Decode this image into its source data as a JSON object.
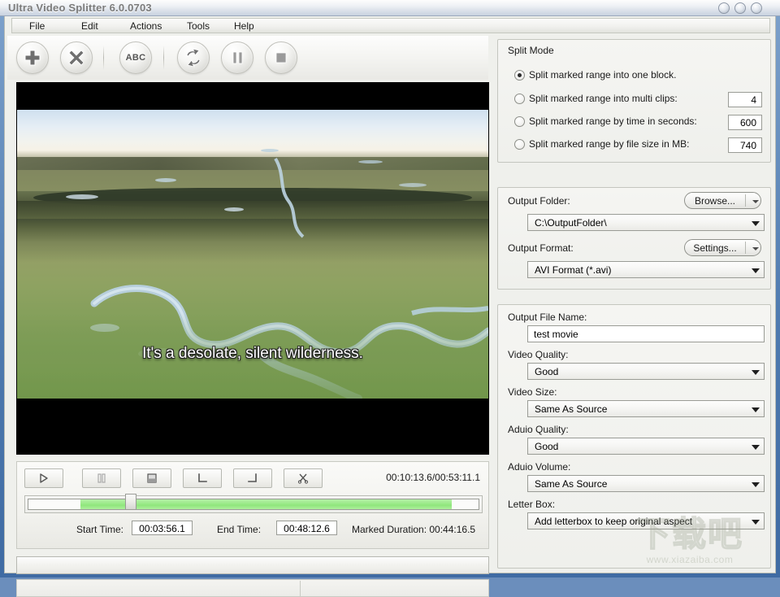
{
  "window": {
    "title": "Ultra Video Splitter 6.0.0703",
    "buttons": [
      {
        "name": "minimize-button",
        "label": ""
      },
      {
        "name": "maximize-button",
        "label": ""
      },
      {
        "name": "close-button",
        "label": ""
      }
    ]
  },
  "menubar": {
    "items": [
      {
        "label": "File"
      },
      {
        "label": "Edit"
      },
      {
        "label": "Actions"
      },
      {
        "label": "Tools"
      },
      {
        "label": "Help"
      }
    ]
  },
  "toolbar": {
    "buttons": [
      {
        "icon": "plus-icon",
        "label": ""
      },
      {
        "icon": "close-x-icon",
        "label": ""
      },
      {
        "icon": "abc-icon",
        "label": "ABC"
      },
      {
        "icon": "convert-refresh-icon",
        "label": ""
      },
      {
        "icon": "pause-icon",
        "label": ""
      },
      {
        "icon": "stop-icon",
        "label": ""
      }
    ]
  },
  "video": {
    "subtitle": "It's a desolate, silent wilderness."
  },
  "player": {
    "buttons": [
      {
        "icon": "play-icon"
      },
      {
        "icon": "pause-icon"
      },
      {
        "icon": "stop-icon"
      },
      {
        "icon": "mark-start-icon"
      },
      {
        "icon": "mark-end-icon"
      },
      {
        "icon": "cut-scissors-icon"
      }
    ],
    "time_display": "00:10:13.6/00:53:11.1",
    "start_time_label": "Start Time:",
    "start_time_value": "00:03:56.1",
    "end_time_label": "End Time:",
    "end_time_value": "00:48:12.6",
    "marked_duration": "Marked Duration: 00:44:16.5",
    "slider": {
      "marked_start_pct": 11.5,
      "marked_end_pct": 94.0,
      "thumb_pct": 23.0,
      "marked_color": "#9aea88"
    }
  },
  "split_mode": {
    "title": "Split Mode",
    "options": [
      {
        "label": "Split  marked range into one block.",
        "selected": true,
        "value": null
      },
      {
        "label": "Split marked range into multi clips:",
        "selected": false,
        "value": "4"
      },
      {
        "label": "Split marked range by time in seconds:",
        "selected": false,
        "value": "600"
      },
      {
        "label": "Split marked range by file size in MB:",
        "selected": false,
        "value": "740"
      }
    ]
  },
  "output": {
    "folder_label": "Output Folder:",
    "browse_button": "Browse...",
    "folder_value": "C:\\OutputFolder\\",
    "format_label": "Output Format:",
    "settings_button": "Settings...",
    "format_value": "AVI Format (*.avi)"
  },
  "output_file": {
    "name_label": "Output File Name:",
    "name_value": "test movie",
    "video_quality_label": "Video Quality:",
    "video_quality_value": "Good",
    "video_size_label": "Video Size:",
    "video_size_value": "Same As Source",
    "audio_quality_label": "Aduio Quality:",
    "audio_quality_value": "Good",
    "audio_volume_label": "Aduio Volume:",
    "audio_volume_value": "Same As Source",
    "letterbox_label": "Letter Box:",
    "letterbox_value": "Add letterbox to keep original aspect"
  },
  "watermark": {
    "cn": "下载吧",
    "url": "www.xiazaiba.com"
  }
}
